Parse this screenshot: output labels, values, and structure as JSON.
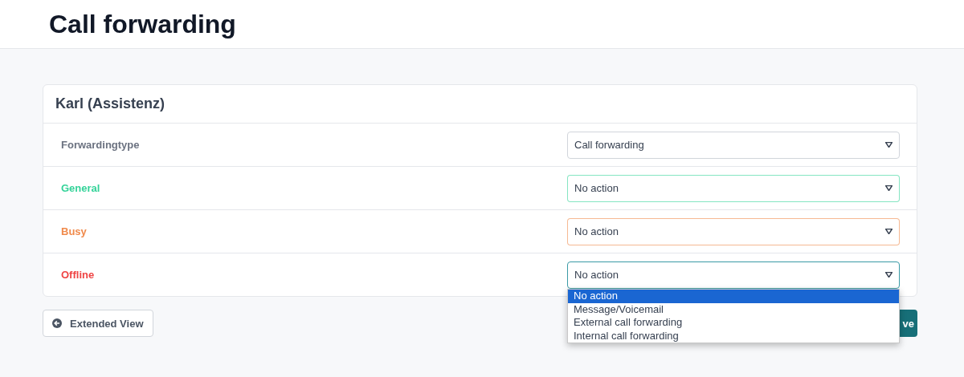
{
  "page_title": "Call forwarding",
  "card": {
    "title": "Karl (Assistenz)",
    "rows": [
      {
        "label": "Forwardingtype",
        "color": "#6b7280",
        "value": "Call forwarding",
        "expanded": false
      },
      {
        "label": "General",
        "color": "#34d399",
        "value": "No action",
        "expanded": false
      },
      {
        "label": "Busy",
        "color": "#f08a4b",
        "value": "No action",
        "expanded": false
      },
      {
        "label": "Offline",
        "color": "#ef4444",
        "value": "No action",
        "expanded": true,
        "options": [
          {
            "label": "No action",
            "selected": true
          },
          {
            "label": "Message/Voicemail",
            "selected": false
          },
          {
            "label": "External call forwarding",
            "selected": false
          },
          {
            "label": "Internal call forwarding",
            "selected": false
          }
        ]
      }
    ]
  },
  "buttons": {
    "extended_view": "Extended View",
    "save": "ve"
  }
}
